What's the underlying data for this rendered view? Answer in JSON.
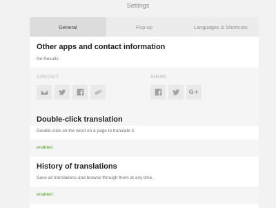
{
  "window": {
    "title": "Settings"
  },
  "tabs": [
    {
      "label": "General",
      "active": true
    },
    {
      "label": "Pop-up",
      "active": false
    },
    {
      "label": "Languages & Shortcuts",
      "active": false
    }
  ],
  "other_apps": {
    "title": "Other apps and contact information",
    "subtitle": "No Results",
    "contact_label": "CONTACT",
    "share_label": "SHARE",
    "contact_icons": [
      "mail-icon",
      "twitter-icon",
      "facebook-icon",
      "link-icon"
    ],
    "share_icons": [
      "facebook-icon",
      "twitter-icon",
      "google-plus-icon"
    ],
    "google_plus_text": "G+"
  },
  "double_click": {
    "title": "Double-click translation",
    "description": "Double-click on the word on a page to translate it.",
    "status": "enabled"
  },
  "history": {
    "title": "History of translations",
    "description": "Save all translations and browse through them at any time.",
    "status": "enabled"
  },
  "colors": {
    "enabled": "#4aa21a",
    "active_tab": "#dcdcdc",
    "tab_bar": "#ececec"
  }
}
